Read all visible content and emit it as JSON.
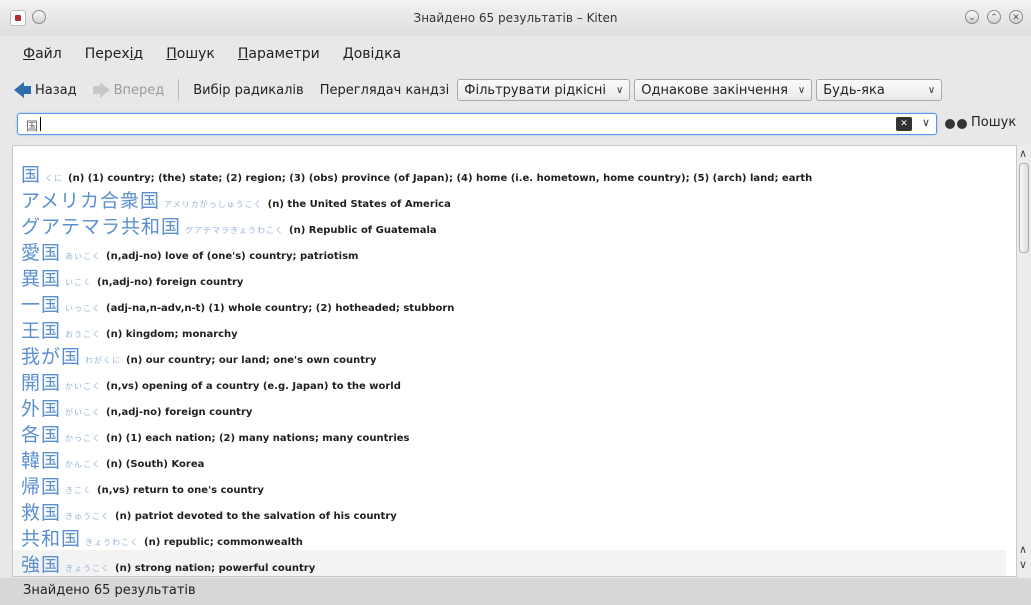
{
  "window": {
    "title": "Знайдено 65 результатів – Kiten"
  },
  "menu": [
    {
      "pre": "",
      "mn": "Ф",
      "post": "айл"
    },
    {
      "pre": "Перех",
      "mn": "і",
      "post": "д"
    },
    {
      "pre": "",
      "mn": "П",
      "post": "ошук"
    },
    {
      "pre": "",
      "mn": "П",
      "post": "араметри"
    },
    {
      "pre": "",
      "mn": "Д",
      "post": "овідка"
    }
  ],
  "toolbar": {
    "back": "Назад",
    "forward": "Вперед",
    "radicals": "Вибір радикалів",
    "kanji_browser": "Переглядач кандзі",
    "filter": "Фільтрувати рідкісні",
    "ending": "Однакове закінчення",
    "any": "Будь-яка"
  },
  "search": {
    "value": "国",
    "button": "Пошук"
  },
  "results": [
    {
      "word": "国",
      "reading": "くに",
      "meaning": "(n) (1) country; (the) state; (2) region; (3) (obs) province (of Japan); (4) home (i.e. hometown, home country); (5) (arch) land; earth"
    },
    {
      "word": "アメリカ合衆国",
      "reading": "アメリカがっしゅうこく",
      "meaning": "(n) the United States of America"
    },
    {
      "word": "グアテマラ共和国",
      "reading": "グアテマラきょうわこく",
      "meaning": "(n) Republic of Guatemala"
    },
    {
      "word": "愛国",
      "reading": "あいこく",
      "meaning": "(n,adj-no) love of (one's) country; patriotism"
    },
    {
      "word": "異国",
      "reading": "いこく",
      "meaning": "(n,adj-no) foreign country"
    },
    {
      "word": "一国",
      "reading": "いっこく",
      "meaning": "(adj-na,n-adv,n-t) (1) whole country; (2) hotheaded; stubborn"
    },
    {
      "word": "王国",
      "reading": "おうこく",
      "meaning": "(n) kingdom; monarchy"
    },
    {
      "word": "我が国",
      "reading": "わがくに",
      "meaning": "(n) our country; our land; one's own country"
    },
    {
      "word": "開国",
      "reading": "かいこく",
      "meaning": "(n,vs) opening of a country (e.g. Japan) to the world"
    },
    {
      "word": "外国",
      "reading": "がいこく",
      "meaning": "(n,adj-no) foreign country"
    },
    {
      "word": "各国",
      "reading": "かっこく",
      "meaning": "(n) (1) each nation; (2) many nations; many countries"
    },
    {
      "word": "韓国",
      "reading": "かんこく",
      "meaning": "(n) (South) Korea"
    },
    {
      "word": "帰国",
      "reading": "きこく",
      "meaning": "(n,vs) return to one's country"
    },
    {
      "word": "救国",
      "reading": "きゅうこく",
      "meaning": "(n) patriot devoted to the salvation of his country"
    },
    {
      "word": "共和国",
      "reading": "きょうわこく",
      "meaning": "(n) republic; commonwealth"
    },
    {
      "word": "強国",
      "reading": "きょうこく",
      "meaning": "(n) strong nation; powerful country"
    }
  ],
  "status": {
    "text": "Знайдено 65 результатів"
  }
}
